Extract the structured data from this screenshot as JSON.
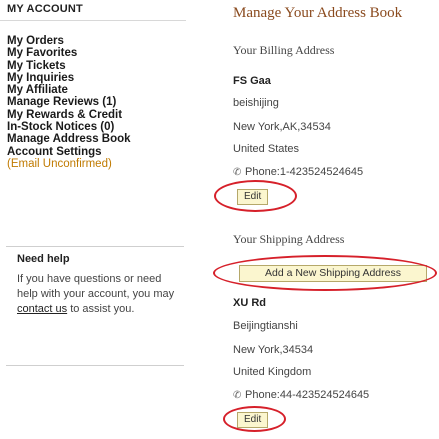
{
  "sidebar": {
    "title": "MY ACCOUNT",
    "items": [
      {
        "label": "My Orders"
      },
      {
        "label": "My Favorites"
      },
      {
        "label": "My Tickets"
      },
      {
        "label": "My Inquiries"
      },
      {
        "label": "My Affiliate"
      },
      {
        "label": "Manage Reviews (1)"
      },
      {
        "label": "My Rewards & Credit"
      },
      {
        "label": "In-Stock Notices (0)"
      },
      {
        "label": "Manage Address Book"
      },
      {
        "label": "Account Settings"
      },
      {
        "label": "(Email Unconfirmed)"
      }
    ],
    "note_color": "#c07a00"
  },
  "help": {
    "title": "Need help",
    "text_before": "If you have questions or need help with your account, you may ",
    "link_text": "contact us",
    "text_after": " to assist you."
  },
  "address_book": {
    "title": "Manage Your Address Book",
    "title_color": "#8a4a1e",
    "billing": {
      "heading": "Your Billing Address",
      "name": "FS Gaa",
      "line1": "beishijing",
      "line2": "New York,AK,34534",
      "country": "United States",
      "phone": "Phone:1-423524524645",
      "edit_label": "Edit"
    },
    "shipping": {
      "heading": "Your Shipping Address",
      "add_label": "Add a New Shipping Address",
      "name": "XU Rd",
      "line1": "Beijingtianshi",
      "line2": "New York,34534",
      "country": "United Kingdom",
      "phone": "Phone:44-423524524645",
      "edit_label": "Edit"
    },
    "annotation_color": "#d6202a",
    "button_color": "#fbf6cf"
  },
  "icons": {
    "phone": "phone-icon"
  }
}
